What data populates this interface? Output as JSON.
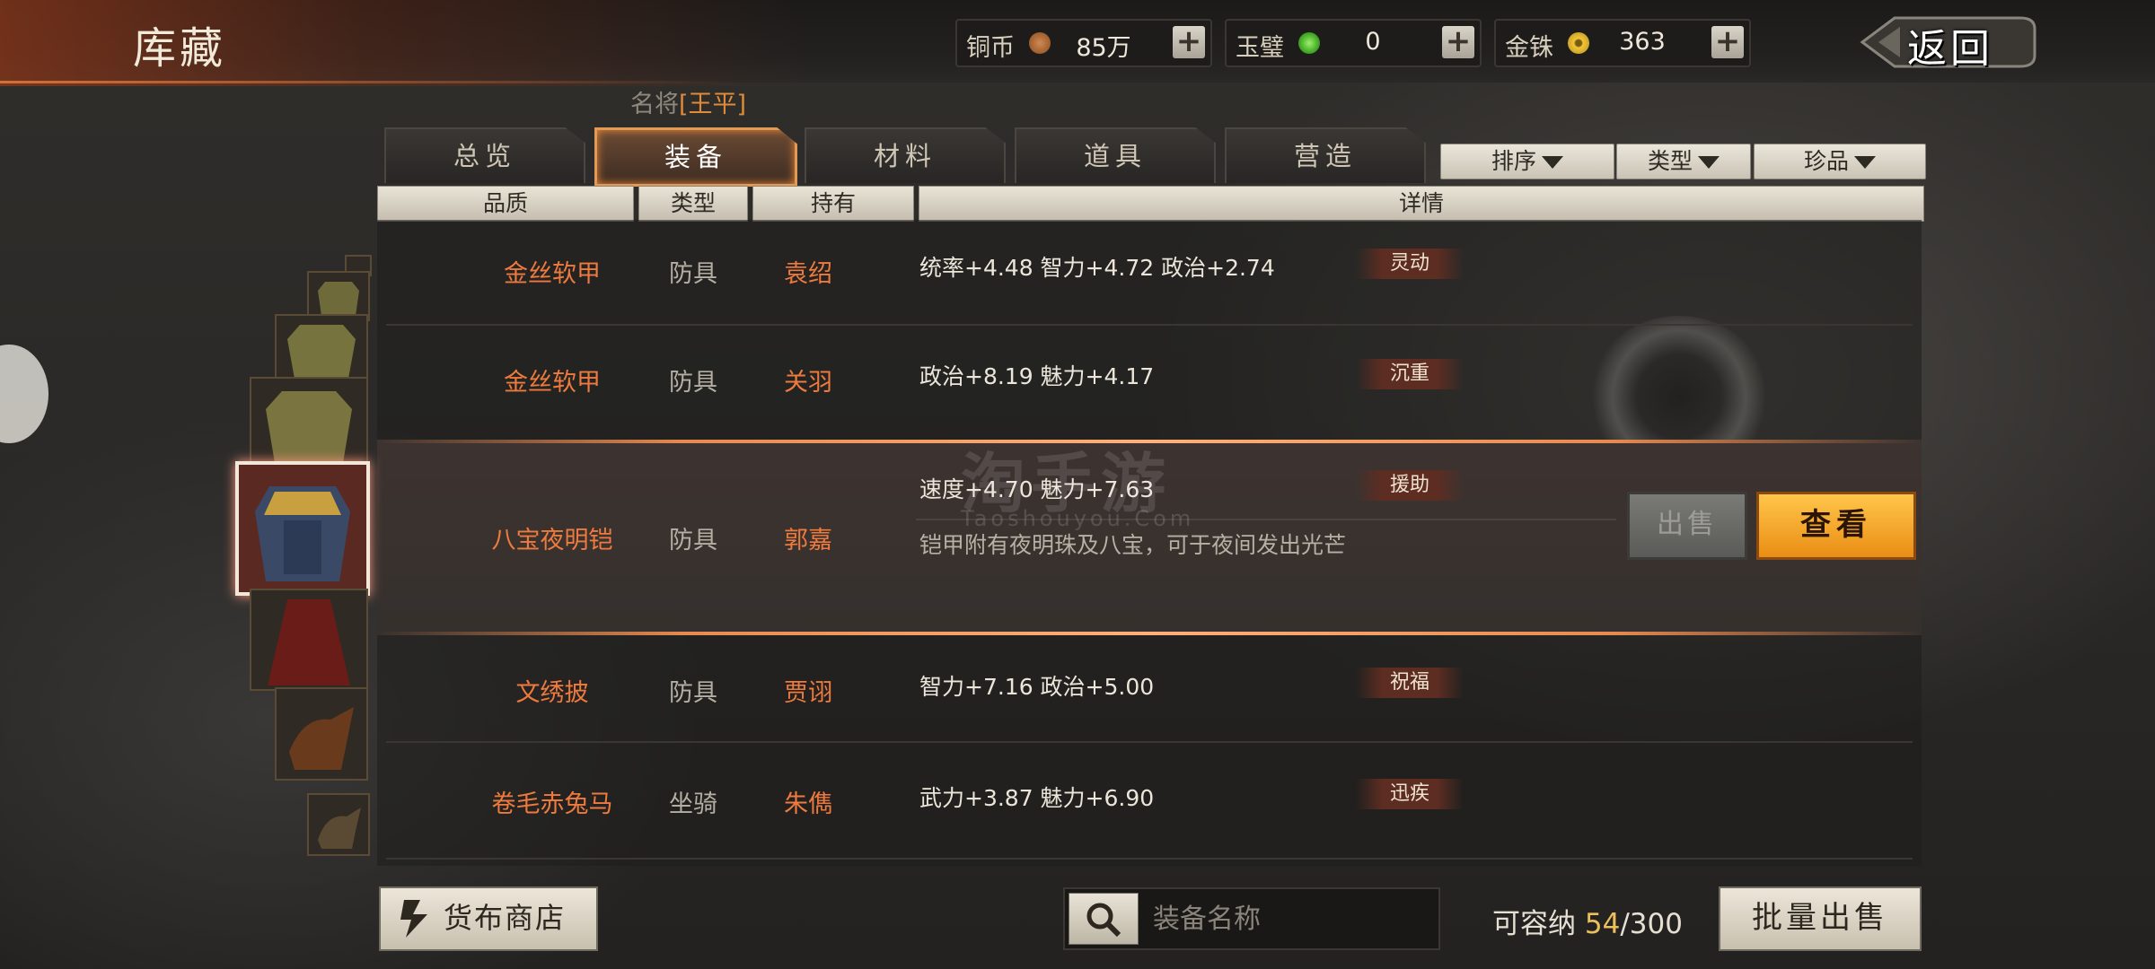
{
  "header": {
    "title": "库藏",
    "back_label": "返回",
    "currencies": [
      {
        "label": "铜币",
        "value": "85万",
        "coin_color": "#b5651d"
      },
      {
        "label": "玉璧",
        "value": "0",
        "coin_color": "#5cc23a"
      },
      {
        "label": "金铢",
        "value": "363",
        "coin_color": "#e2b523"
      }
    ],
    "plus_label": "+"
  },
  "hero": {
    "prefix": "名将",
    "name": "[王平]"
  },
  "tabs": [
    {
      "label": "总览"
    },
    {
      "label": "装备",
      "active": true
    },
    {
      "label": "材料"
    },
    {
      "label": "道具"
    },
    {
      "label": "营造"
    }
  ],
  "filters": [
    {
      "label": "排序"
    },
    {
      "label": "类型"
    },
    {
      "label": "珍品"
    }
  ],
  "columns": {
    "quality": "品质",
    "type": "类型",
    "owner": "持有",
    "detail": "详情"
  },
  "items": [
    {
      "name": "金丝软甲",
      "type": "防具",
      "owner": "袁绍",
      "stats": "统率+4.48  智力+4.72  政治+2.74",
      "trait": "灵动"
    },
    {
      "name": "金丝软甲",
      "type": "防具",
      "owner": "关羽",
      "stats": "政治+8.19  魅力+4.17",
      "trait": "沉重"
    },
    {
      "name": "八宝夜明铠",
      "type": "防具",
      "owner": "郭嘉",
      "stats": "速度+4.70  魅力+7.63",
      "trait": "援助",
      "desc": "铠甲附有夜明珠及八宝，可于夜间发出光芒",
      "selected": true
    },
    {
      "name": "文绣披",
      "type": "防具",
      "owner": "贾诩",
      "stats": "智力+7.16  政治+5.00",
      "trait": "祝福"
    },
    {
      "name": "卷毛赤兔马",
      "type": "坐骑",
      "owner": "朱儁",
      "stats": "武力+3.87  魅力+6.90",
      "trait": "迅疾"
    }
  ],
  "actions": {
    "sell": "出售",
    "view": "查看"
  },
  "footer": {
    "shop_label": "货布商店",
    "search_placeholder": "装备名称",
    "capacity_label": "可容纳",
    "capacity_current": "54",
    "capacity_max": "/300",
    "batch_sell_label": "批量出售"
  },
  "watermark": {
    "main": "淘手游",
    "sub": "Taoshouyou.Com"
  },
  "colors": {
    "accent": "#ee7a3e",
    "gold_button": "#f5a623",
    "selected_glow": "#ffb07a"
  }
}
